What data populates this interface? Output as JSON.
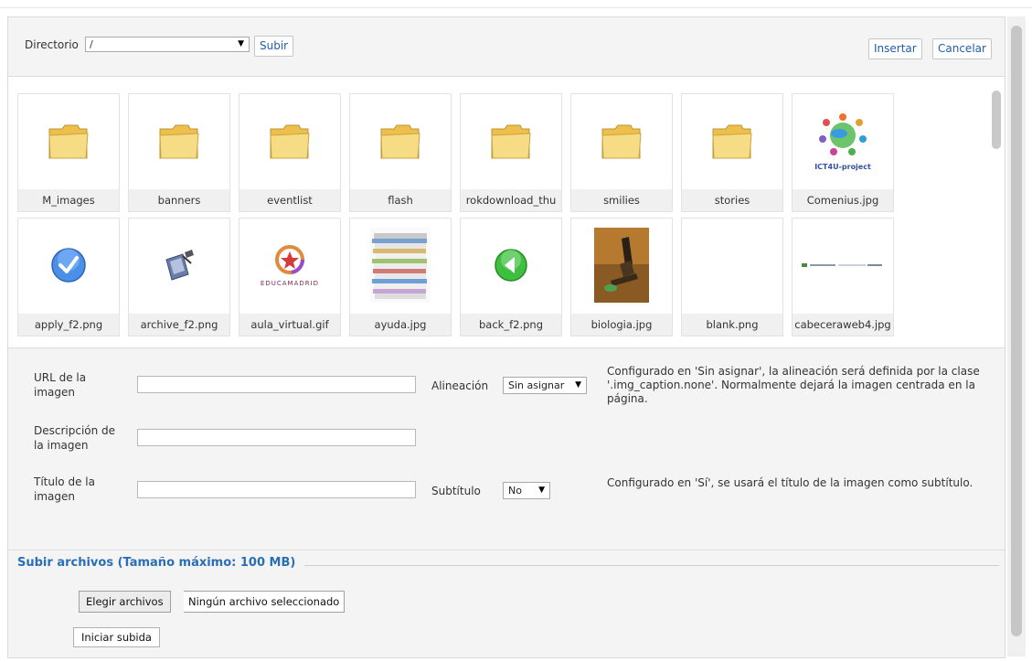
{
  "toolbar": {
    "directory_label": "Directorio",
    "directory_value": "/",
    "upload_dir_button": "Subir",
    "insert_button": "Insertar",
    "cancel_button": "Cancelar"
  },
  "files": [
    {
      "name": "M_images",
      "icon": "folder-icon"
    },
    {
      "name": "banners",
      "icon": "folder-icon"
    },
    {
      "name": "eventlist",
      "icon": "folder-icon"
    },
    {
      "name": "flash",
      "icon": "folder-icon"
    },
    {
      "name": "rokdownload_thu",
      "icon": "folder-icon"
    },
    {
      "name": "smilies",
      "icon": "folder-icon"
    },
    {
      "name": "stories",
      "icon": "folder-icon"
    },
    {
      "name": "Comenius.jpg",
      "icon": "comenius-thumbnail",
      "thumb_text": "ICT4U-project"
    },
    {
      "name": "apply_f2.png",
      "icon": "checkmark-icon"
    },
    {
      "name": "archive_f2.png",
      "icon": "archive-icon"
    },
    {
      "name": "aula_virtual.gif",
      "icon": "educamadrid-logo",
      "thumb_text": "EDUCAMADRID"
    },
    {
      "name": "ayuda.jpg",
      "icon": "paper-stack-thumbnail"
    },
    {
      "name": "back_f2.png",
      "icon": "back-arrow-icon"
    },
    {
      "name": "biologia.jpg",
      "icon": "microscope-thumbnail"
    },
    {
      "name": "blank.png",
      "icon": "blank-thumbnail"
    },
    {
      "name": "cabeceraweb4.jpg",
      "icon": "header-banner-thumbnail"
    }
  ],
  "details": {
    "url_label": "URL de la imagen",
    "url_value": "",
    "description_label": "Descripción de la imagen",
    "description_value": "",
    "title_label": "Título de la imagen",
    "title_value": "",
    "align_label": "Alineación",
    "align_value": "Sin asignar",
    "align_help": "Configurado en 'Sin asignar', la alineación será definida por la clase '.img_caption.none'. Normalmente dejará la imagen centrada en la página.",
    "caption_label": "Subtítulo",
    "caption_value": "No",
    "caption_help": "Configurado en 'Sí', se usará el título de la imagen como subtítulo."
  },
  "upload": {
    "title": "Subir archivos (Tamaño máximo: 100 MB)",
    "choose_button": "Elegir archivos",
    "no_file_text": "Ningún archivo seleccionado",
    "start_button": "Iniciar subida"
  },
  "colors": {
    "accent": "#2a6fb5",
    "link": "#1f5fa6",
    "folder": "#f6d775",
    "background": "#f4f4f4"
  }
}
